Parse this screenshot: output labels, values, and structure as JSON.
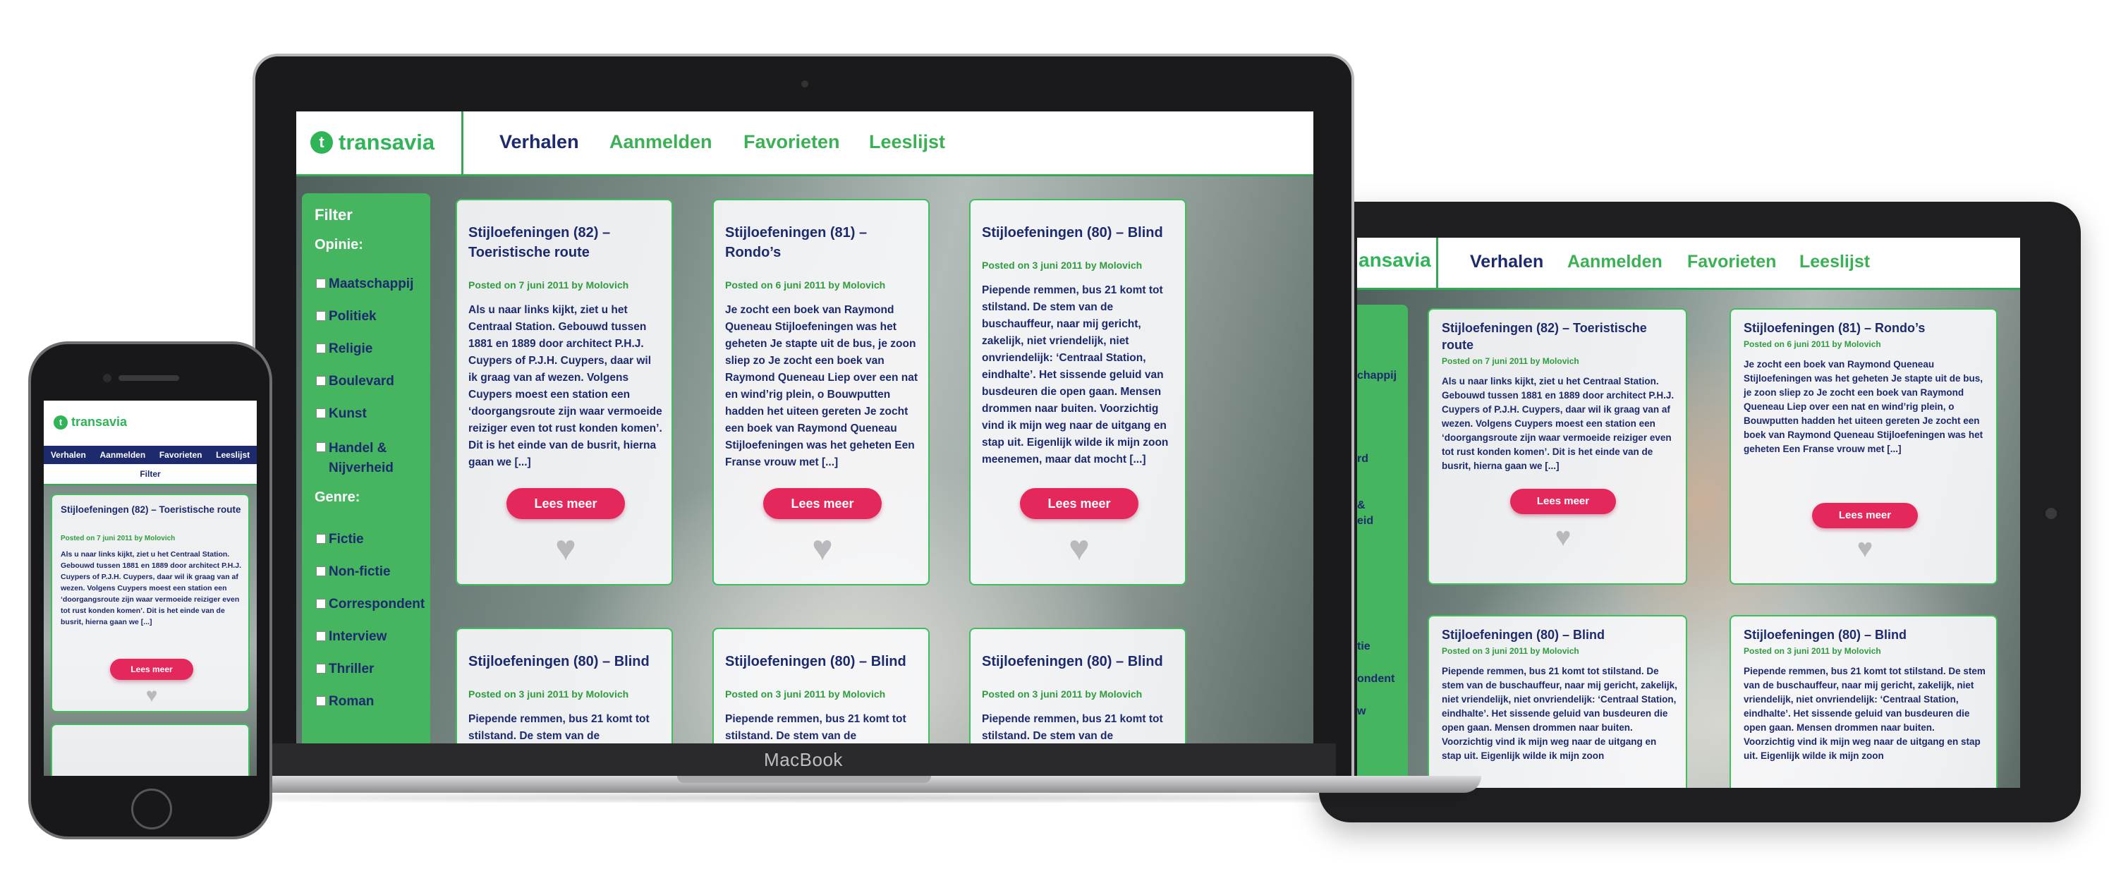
{
  "brand": {
    "name": "transavia",
    "logo_mark": "t",
    "accent": "#2fb457",
    "nav_active": "#1d2a6e",
    "button": "#e5285b"
  },
  "device_label": "MacBook",
  "nav": [
    {
      "label": "Verhalen",
      "active": true
    },
    {
      "label": "Aanmelden",
      "active": false
    },
    {
      "label": "Favorieten",
      "active": false
    },
    {
      "label": "Leeslijst",
      "active": false
    }
  ],
  "filter": {
    "title": "Filter",
    "opinie_label": "Opinie:",
    "opinie": [
      "Maatschappij",
      "Politiek",
      "Religie",
      "Boulevard",
      "Kunst",
      "Handel & Nijverheid"
    ],
    "genre_label": "Genre:",
    "genre": [
      "Fictie",
      "Non-fictie",
      "Correspondent",
      "Interview",
      "Thriller",
      "Roman"
    ]
  },
  "tablet_filter_fragments": [
    "chappij",
    "rd",
    "&",
    "eid",
    "tie",
    "ondent",
    "w"
  ],
  "laptop_cards": [
    {
      "title": "Stijloefeningen (82) – Toeristische route",
      "meta": "Posted on 7 juni 2011 by Molovich",
      "text": "Als u naar links kijkt, ziet u het Centraal Station. Gebouwd tussen 1881 en 1889 door architect P.H.J. Cuypers of P.J.H. Cuypers, daar wil ik graag van af wezen. Volgens Cuypers moest een station een ‘doorgangsroute zijn waar vermoeide reiziger even tot rust konden komen’. Dit is het einde van de busrit, hierna gaan we [...]",
      "button": "Lees meer"
    },
    {
      "title": "Stijloefeningen (81) – Rondo’s",
      "meta": "Posted on 6 juni 2011 by Molovich",
      "text": "Je zocht een boek van Raymond Queneau Stijloefeningen was het geheten Je stapte uit de bus, je zoon sliep zo Je zocht een boek van Raymond Queneau Liep over een nat en wind’rig plein, o Bouwputten hadden het uiteen gereten Je zocht een boek van Raymond Queneau Stijloefeningen was het geheten Een Franse vrouw met [...]",
      "button": "Lees meer"
    },
    {
      "title": "Stijloefeningen (80) – Blind",
      "meta": "Posted on 3 juni 2011 by Molovich",
      "text": "Piepende remmen, bus 21 komt tot stilstand. De stem van de buschauffeur, naar mij gericht, zakelijk, niet vriendelijk, niet onvriendelijk: ‘Centraal Station, eindhalte’. Het sissende geluid van busdeuren die open gaan. Mensen drommen naar buiten. Voorzichtig vind ik mijn weg naar de uitgang en stap uit. Eigenlijk wilde ik mijn zoon meenemen, maar dat mocht [...]",
      "button": "Lees meer"
    },
    {
      "title": "Stijloefeningen (80) – Blind",
      "meta": "Posted on 3 juni 2011 by Molovich",
      "text": "Piepende remmen, bus 21 komt tot stilstand. De stem van de"
    },
    {
      "title": "Stijloefeningen (80) – Blind",
      "meta": "Posted on 3 juni 2011 by Molovich",
      "text": "Piepende remmen, bus 21 komt tot stilstand. De stem van de"
    },
    {
      "title": "Stijloefeningen (80) – Blind",
      "meta": "Posted on 3 juni 2011 by Molovich",
      "text": "Piepende remmen, bus 21 komt tot stilstand. De stem van de"
    }
  ],
  "tablet_cards": [
    {
      "title": "Stijloefeningen (82) – Toeristische route",
      "meta": "Posted on 7 juni 2011 by Molovich",
      "text": "Als u naar links kijkt, ziet u het Centraal Station. Gebouwd tussen 1881 en 1889 door architect P.H.J. Cuypers of P.J.H. Cuypers, daar wil ik graag van af wezen. Volgens Cuypers moest een station een ‘doorgangsroute zijn waar vermoeide reiziger even tot rust konden komen’. Dit is het einde van de busrit, hierna gaan we [...]",
      "button": "Lees meer"
    },
    {
      "title": "Stijloefeningen (81) – Rondo’s",
      "meta": "Posted on 6 juni 2011 by Molovich",
      "text": "Je zocht een boek van Raymond Queneau Stijloefeningen was het geheten Je stapte uit de bus, je zoon sliep zo Je zocht een boek van Raymond Queneau Liep over een nat en wind’rig plein, o Bouwputten hadden het uiteen gereten Je zocht een boek van Raymond Queneau Stijloefeningen was het geheten Een Franse vrouw met [...]",
      "button": "Lees meer"
    },
    {
      "title": "Stijloefeningen (80) – Blind",
      "meta": "Posted on 3 juni 2011 by Molovich",
      "text": "Piepende remmen, bus 21 komt tot stilstand. De stem van de buschauffeur, naar mij gericht, zakelijk, niet vriendelijk, niet onvriendelijk: ‘Centraal Station, eindhalte’. Het sissende geluid van busdeuren die open gaan. Mensen drommen naar buiten. Voorzichtig vind ik mijn weg naar de uitgang en stap uit. Eigenlijk wilde ik mijn zoon"
    },
    {
      "title": "Stijloefeningen (80) – Blind",
      "meta": "Posted on 3 juni 2011 by Molovich",
      "text": "Piepende remmen, bus 21 komt tot stilstand. De stem van de buschauffeur, naar mij gericht, zakelijk, niet vriendelijk, niet onvriendelijk: ‘Centraal Station, eindhalte’. Het sissende geluid van busdeuren die open gaan. Mensen drommen naar buiten. Voorzichtig vind ik mijn weg naar de uitgang en stap uit. Eigenlijk wilde ik mijn zoon"
    }
  ],
  "phone": {
    "filter_label": "Filter",
    "card": {
      "title": "Stijloefeningen (82) – Toeristische route",
      "meta": "Posted on 7 juni 2011 by Molovich",
      "text": "Als u naar links kijkt, ziet u het Centraal Station. Gebouwd tussen 1881 en 1889 door architect P.H.J. Cuypers of P.J.H. Cuypers, daar wil ik graag van af wezen. Volgens Cuypers moest een station een ‘doorgangsroute zijn waar vermoeide reiziger even tot rust konden komen’. Dit is het einde van de busrit, hierna gaan we [...]",
      "button": "Lees meer"
    }
  },
  "icons": {
    "heart": "heart-icon",
    "logo": "transavia-logo-icon"
  }
}
